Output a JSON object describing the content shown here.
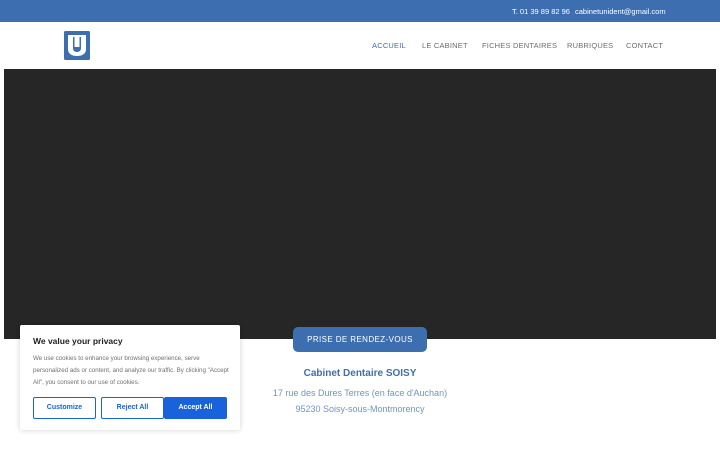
{
  "topbar": {
    "phone": "T. 01 39 89 82 96",
    "email": "cabinetunident@gmail.com"
  },
  "header": {
    "logo_icon": "tooth-logo-icon",
    "nav": [
      {
        "label": "ACCUEIL",
        "active": true
      },
      {
        "label": "LE CABINET",
        "active": false
      },
      {
        "label": "FICHES DENTAIRES",
        "active": false
      },
      {
        "label": "RUBRIQUES",
        "active": false
      },
      {
        "label": "CONTACT",
        "active": false
      }
    ]
  },
  "hero": {
    "color": "#262626"
  },
  "main": {
    "rdv_button": "PRISE DE RENDEZ-VOUS",
    "cabinet_name": "Cabinet Dentaire SOISY",
    "address_line1": "17 rue des Dures Terres (en face d'Auchan)",
    "address_line2": "95230 Soisy-sous-Montmorency"
  },
  "cookie": {
    "title": "We value your privacy",
    "text": "We use cookies to enhance your browsing experience, serve personalized ads or content, and analyze our traffic. By clicking \"Accept All\", you consent to our use of cookies.",
    "customize": "Customize",
    "reject": "Reject All",
    "accept": "Accept All"
  },
  "colors": {
    "brand": "#3d6fb0",
    "cookie_accent": "#1863dc"
  }
}
